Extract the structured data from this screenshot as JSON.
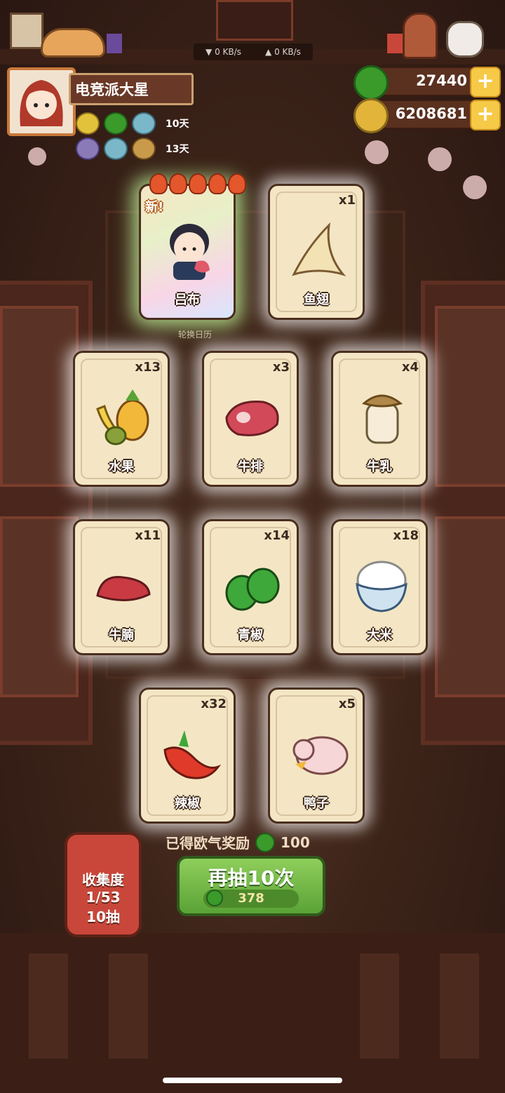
{
  "network": {
    "down": "▼ 0 KB/s",
    "up": "▲ 0 KB/s"
  },
  "player": {
    "name": "电竞派大星"
  },
  "buffs": [
    {
      "days": "10天"
    },
    {
      "days": "13天"
    }
  ],
  "resources": [
    {
      "name": "green-gem",
      "value": "27440",
      "plus": "+",
      "color": "#3a9a2a"
    },
    {
      "name": "gold-coin",
      "value": "6208681",
      "plus": "+",
      "color": "#e2b43a"
    }
  ],
  "background_sign": "轮换日历",
  "cards": [
    {
      "label": "吕布",
      "count": "",
      "new": "新!"
    },
    {
      "label": "鱼翅",
      "count": "x1"
    },
    {
      "label": "水果",
      "count": "x13"
    },
    {
      "label": "牛排",
      "count": "x3"
    },
    {
      "label": "牛乳",
      "count": "x4"
    },
    {
      "label": "牛腩",
      "count": "x11"
    },
    {
      "label": "青椒",
      "count": "x14"
    },
    {
      "label": "大米",
      "count": "x18"
    },
    {
      "label": "辣椒",
      "count": "x32"
    },
    {
      "label": "鸭子",
      "count": "x5"
    }
  ],
  "reward": {
    "label": "已得欧气奖励",
    "value": "100"
  },
  "collection": {
    "title": "收集度",
    "progress": "1/53",
    "draws": "10抽"
  },
  "draw_again": {
    "label": "再抽10次",
    "cost": "378"
  }
}
